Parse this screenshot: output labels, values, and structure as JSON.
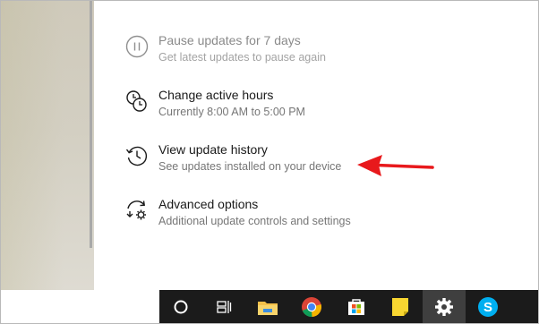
{
  "options": [
    {
      "icon": "pause-icon",
      "title": "Pause updates for 7 days",
      "desc": "Get latest updates to pause again",
      "enabled": false
    },
    {
      "icon": "active-hours-icon",
      "title": "Change active hours",
      "desc": "Currently 8:00 AM to 5:00 PM",
      "enabled": true
    },
    {
      "icon": "history-icon",
      "title": "View update history",
      "desc": "See updates installed on your device",
      "enabled": true
    },
    {
      "icon": "advanced-options-icon",
      "title": "Advanced options",
      "desc": "Additional update controls and settings",
      "enabled": true
    }
  ],
  "annotation": {
    "color": "#e8191c",
    "points_to": "View update history"
  },
  "taskbar": {
    "items": [
      "cortana-icon",
      "task-view-icon",
      "file-explorer-icon",
      "chrome-icon",
      "store-icon",
      "sticky-notes-icon",
      "settings-icon",
      "skype-icon"
    ],
    "active": "settings-icon"
  },
  "colors": {
    "accent_text": "#1a1a1a",
    "muted_text": "#767676",
    "taskbar_bg": "#1b1b1b",
    "taskbar_active": "#3f3f3f"
  }
}
